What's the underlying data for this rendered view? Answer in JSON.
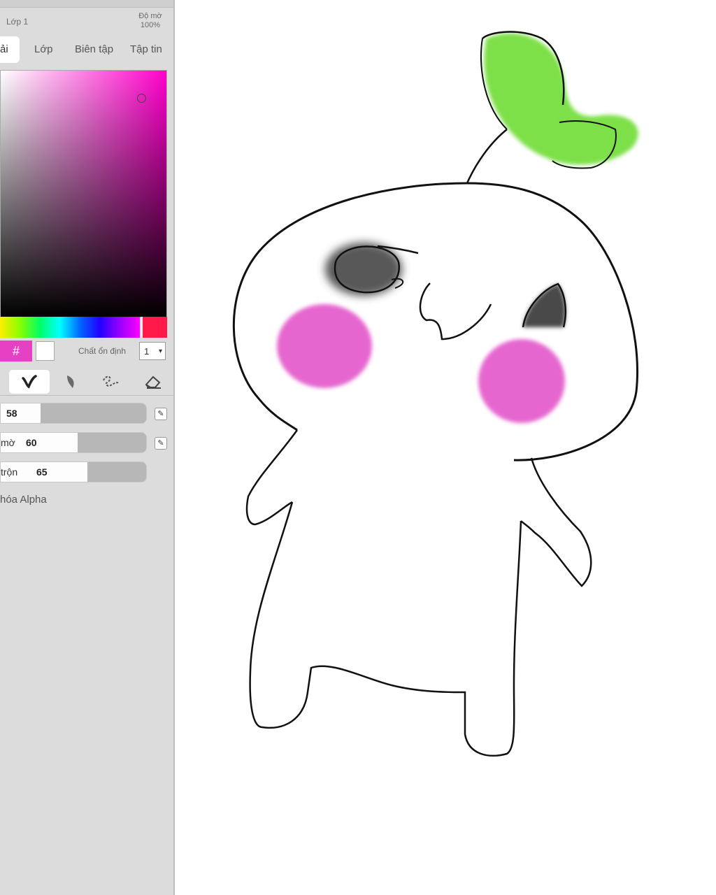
{
  "panel": {
    "layer_label": "Lớp 1",
    "opacity_title_line1": "Độ mờ",
    "opacity_value": "100%",
    "tabs": [
      {
        "label": "ải",
        "active": true
      },
      {
        "label": "Lớp",
        "active": false
      },
      {
        "label": "Biên tập",
        "active": false
      },
      {
        "label": "Tập tin",
        "active": false
      }
    ],
    "hex_symbol": "#",
    "stabilizer_label": "Chất ổn định",
    "stabilizer_value": "1",
    "brush_tools": [
      {
        "name": "brush-tool-1",
        "icon": "stroke-icon",
        "glyph": "✔",
        "active": false
      },
      {
        "name": "brush-tool-2",
        "icon": "pen-stroke-icon",
        "glyph": "✔",
        "active": true
      },
      {
        "name": "brush-tool-3",
        "icon": "feather-icon",
        "glyph": "✒",
        "active": false
      },
      {
        "name": "brush-tool-4",
        "icon": "smudge-icon",
        "glyph": "⌇",
        "active": false
      },
      {
        "name": "brush-tool-5",
        "icon": "eraser-icon",
        "glyph": "⌫",
        "active": false
      }
    ],
    "sliders": [
      {
        "label": "",
        "value": "58",
        "fill_fraction": 0.27
      },
      {
        "label": "mờ",
        "value": "60",
        "fill_fraction": 0.53
      },
      {
        "label": "trộn",
        "value": "65",
        "fill_fraction": 0.6
      }
    ],
    "alpha_label": "hóa Alpha"
  },
  "colors": {
    "current_color": "#e641c3",
    "hue_marker": "#ff1a4a",
    "sprout_green": "#7ee04a",
    "blush_pink": "#e35acb",
    "eye_gray": "#4a4a4a"
  }
}
